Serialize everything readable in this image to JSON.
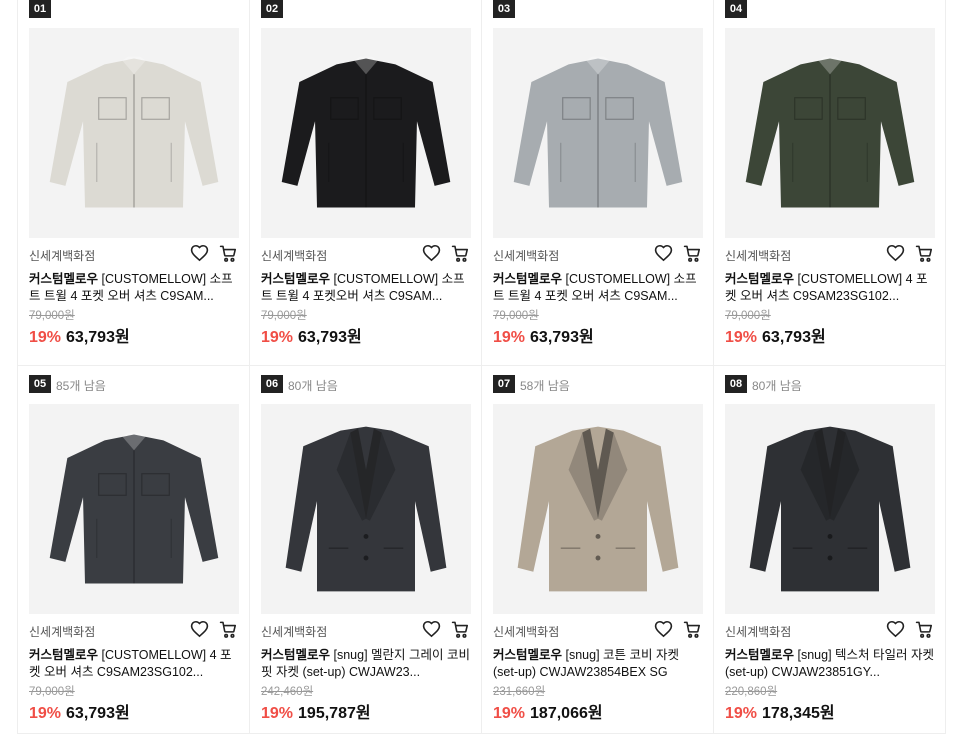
{
  "products": [
    {
      "rank": "01",
      "remaining": "",
      "shop": "신세계백화점",
      "brand": "커스텀멜로우",
      "name": " [CUSTOMELLOW] 소프트 트윌 4 포켓 오버 셔츠 C9SAM...",
      "original_price": "79,000원",
      "discount": "19%",
      "price": "63,793원",
      "image": {
        "kind": "shirt",
        "color": "#dcdad3"
      }
    },
    {
      "rank": "02",
      "remaining": "",
      "shop": "신세계백화점",
      "brand": "커스텀멜로우",
      "name": " [CUSTOMELLOW] 소프트 트윌 4 포켓오버 셔츠 C9SAM...",
      "original_price": "79,000원",
      "discount": "19%",
      "price": "63,793원",
      "image": {
        "kind": "shirt",
        "color": "#1b1b1d"
      }
    },
    {
      "rank": "03",
      "remaining": "",
      "shop": "신세계백화점",
      "brand": "커스텀멜로우",
      "name": " [CUSTOMELLOW] 소프트 트윌 4 포켓 오버 셔츠 C9SAM...",
      "original_price": "79,000원",
      "discount": "19%",
      "price": "63,793원",
      "image": {
        "kind": "shirt",
        "color": "#a7acb0"
      }
    },
    {
      "rank": "04",
      "remaining": "",
      "shop": "신세계백화점",
      "brand": "커스텀멜로우",
      "name": " [CUSTOMELLOW] 4 포켓 오버 셔츠 C9SAM23SG102...",
      "original_price": "79,000원",
      "discount": "19%",
      "price": "63,793원",
      "image": {
        "kind": "shirt",
        "color": "#3c4637"
      }
    },
    {
      "rank": "05",
      "remaining": "85개 남음",
      "shop": "신세계백화점",
      "brand": "커스텀멜로우",
      "name": " [CUSTOMELLOW] 4 포켓 오버 셔츠 C9SAM23SG102...",
      "original_price": "79,000원",
      "discount": "19%",
      "price": "63,793원",
      "image": {
        "kind": "shirt",
        "color": "#3a3d42"
      }
    },
    {
      "rank": "06",
      "remaining": "80개 남음",
      "shop": "신세계백화점",
      "brand": "커스텀멜로우",
      "name": " [snug] 멜란지 그레이 코비 핏 자켓 (set-up) CWJAW23...",
      "original_price": "242,460원",
      "discount": "19%",
      "price": "195,787원",
      "image": {
        "kind": "blazer",
        "color": "#34363b"
      }
    },
    {
      "rank": "07",
      "remaining": "58개 남음",
      "shop": "신세계백화점",
      "brand": "커스텀멜로우",
      "name": " [snug] 코튼 코비 자켓 (set-up) CWJAW23854BEX SG",
      "original_price": "231,660원",
      "discount": "19%",
      "price": "187,066원",
      "image": {
        "kind": "blazer",
        "color": "#b3a796"
      }
    },
    {
      "rank": "08",
      "remaining": "80개 남음",
      "shop": "신세계백화점",
      "brand": "커스텀멜로우",
      "name": " [snug] 텍스처 타일러 자켓(set-up) CWJAW23851GY...",
      "original_price": "220,860원",
      "discount": "19%",
      "price": "178,345원",
      "image": {
        "kind": "blazer",
        "color": "#2e3034"
      }
    }
  ],
  "icons": {
    "wishlist": "heart-icon",
    "cart": "cart-icon"
  },
  "colors": {
    "discount": "#f04e46",
    "rank_badge": "#222222"
  }
}
